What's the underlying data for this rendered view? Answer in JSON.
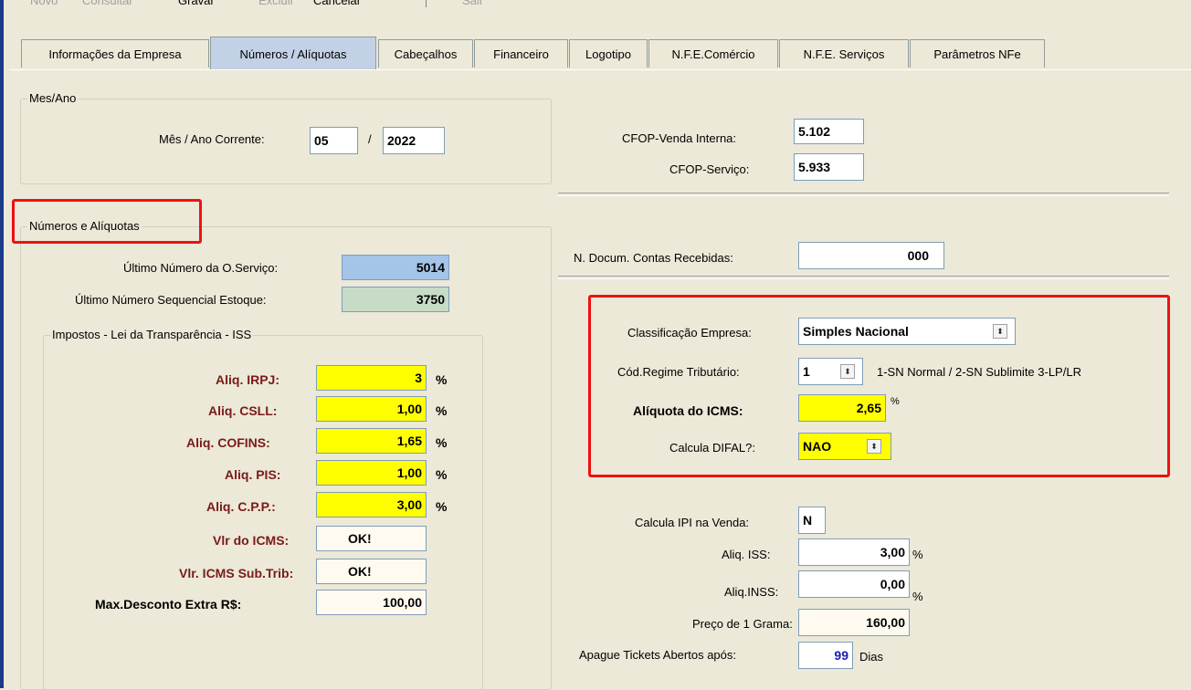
{
  "toolbar": {
    "novo": "Novo",
    "consultar": "Consultar",
    "gravar": "Gravar",
    "excluir": "Excluir",
    "cancelar": "Cancelar",
    "sair": "Sair"
  },
  "tabs": [
    {
      "label": "Informações da Empresa"
    },
    {
      "label": "Números / Alíquotas"
    },
    {
      "label": "Cabeçalhos"
    },
    {
      "label": "Financeiro"
    },
    {
      "label": "Logotipo"
    },
    {
      "label": "N.F.E.Comércio"
    },
    {
      "label": "N.F.E. Serviços"
    },
    {
      "label": "Parâmetros NFe"
    }
  ],
  "mesano": {
    "group_title": "Mes/Ano",
    "label": "Mês / Ano Corrente:",
    "month": "05",
    "slash": "/",
    "year": "2022"
  },
  "numeros": {
    "group_title": "Números e Alíquotas",
    "ultimo_os_label": "Último Número da O.Serviço:",
    "ultimo_os_value": "5014",
    "ultimo_estoque_label": "Último Número Sequencial Estoque:",
    "ultimo_estoque_value": "3750"
  },
  "impostos": {
    "group_title": "Impostos - Lei da Transparência - ISS",
    "irpj_label": "Aliq. IRPJ:",
    "irpj_value": "3",
    "csll_label": "Aliq. CSLL:",
    "csll_value": "1,00",
    "cofins_label": "Aliq. COFINS:",
    "cofins_value": "1,65",
    "pis_label": "Aliq. PIS:",
    "pis_value": "1,00",
    "cpp_label": "Aliq. C.P.P.:",
    "cpp_value": "3,00",
    "pct": "%",
    "vlr_icms_label": "Vlr do ICMS:",
    "vlr_icms_value": "OK!",
    "vlr_icms_st_label": "Vlr. ICMS Sub.Trib:",
    "vlr_icms_st_value": "OK!",
    "max_desc_label": "Max.Desconto Extra R$:",
    "max_desc_value": "100,00"
  },
  "cfop": {
    "venda_label": "CFOP-Venda Interna:",
    "venda_value": "5.102",
    "servico_label": "CFOP-Serviço:",
    "servico_value": "5.933"
  },
  "contas": {
    "label": "N. Docum. Contas Recebidas:",
    "value": "000"
  },
  "classificacao": {
    "empresa_label": "Classificação Empresa:",
    "empresa_value": "Simples Nacional",
    "regime_label": "Cód.Regime Tributário:",
    "regime_value": "1",
    "regime_hint": "1-SN Normal / 2-SN Sublimite 3-LP/LR",
    "icms_label": "Alíquota do ICMS:",
    "icms_value": "2,65",
    "icms_pct": "%",
    "difal_label": "Calcula DIFAL?:",
    "difal_value": "NAO"
  },
  "outros": {
    "ipi_label": "Calcula IPI na Venda:",
    "ipi_value": "N",
    "iss_label": "Aliq. ISS:",
    "iss_value": "3,00",
    "iss_pct": "%",
    "inss_label": "Aliq.INSS:",
    "inss_value": "0,00",
    "inss_pct": "%",
    "grama_label": "Preço de 1 Grama:",
    "grama_value": "160,00",
    "tickets_label": "Apague Tickets Abertos após:",
    "tickets_value": "99",
    "tickets_unit": "Dias"
  },
  "colors": {
    "highlight_box": "#ee1111",
    "yellow_field": "#ffff00",
    "active_tab": "#c3d1e6"
  },
  "icons": {
    "spinner": "updown-spinner-icon"
  }
}
